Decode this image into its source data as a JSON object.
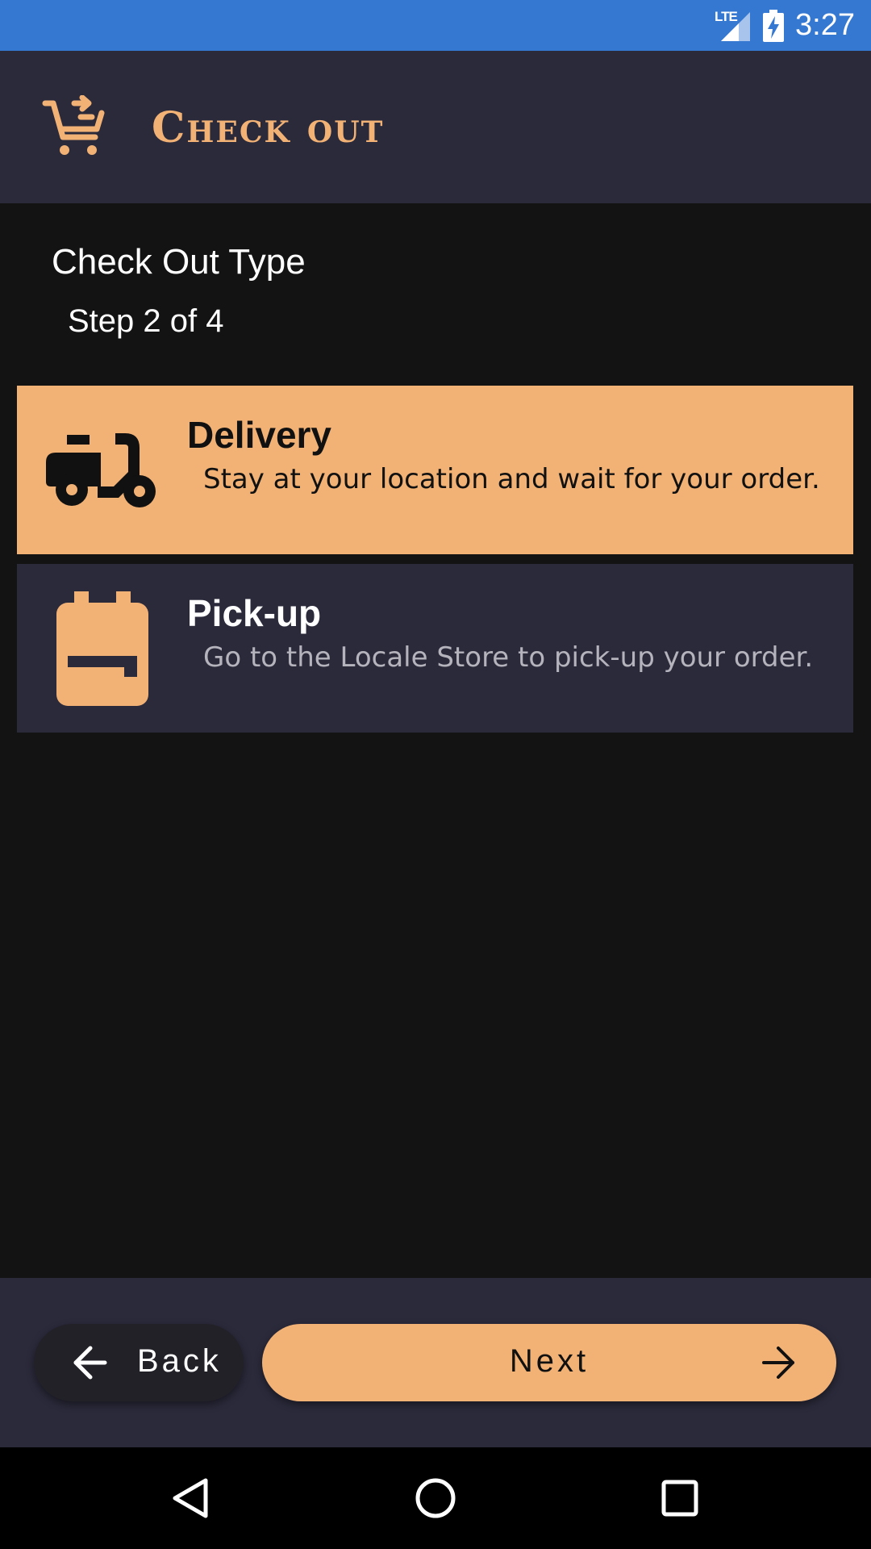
{
  "status_bar": {
    "network": "LTE",
    "time": "3:27",
    "icons": [
      "signal-icon",
      "battery-charging-icon"
    ]
  },
  "app_bar": {
    "title": "Check out",
    "icon": "cart-arrow-icon"
  },
  "section": {
    "title": "Check Out Type",
    "step": "Step 2 of 4"
  },
  "options": [
    {
      "title": "Delivery",
      "description": "Stay at your location and wait for your order.",
      "icon": "scooter-icon",
      "selected": true
    },
    {
      "title": "Pick-up",
      "description": "Go to the Locale Store to pick-up your order.",
      "icon": "bag-icon",
      "selected": false
    }
  ],
  "buttons": {
    "back": "Back",
    "next": "Next"
  },
  "nav_bar": {
    "icons": [
      "back-triangle-icon",
      "home-circle-icon",
      "recents-square-icon"
    ]
  },
  "colors": {
    "accent": "#f2b276",
    "status_bar": "#3478d2",
    "surface": "#2b2a3b",
    "background": "#131314"
  }
}
